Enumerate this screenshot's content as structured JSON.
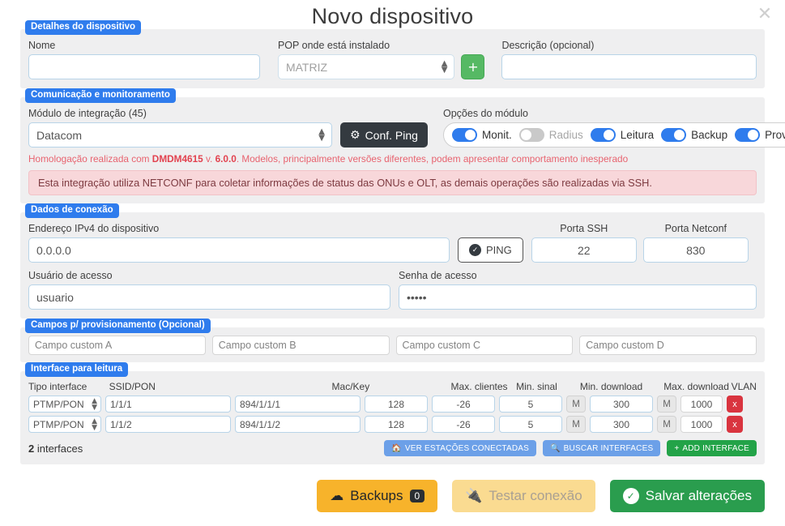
{
  "header": {
    "title": "Novo dispositivo",
    "close_icon": "close-icon"
  },
  "device_details": {
    "legend": "Detalhes do dispositivo",
    "name_label": "Nome",
    "name_value": "",
    "pop_label": "POP onde está instalado",
    "pop_value": "MATRIZ",
    "add_pop_icon": "+",
    "description_label": "Descrição (opcional)",
    "description_value": ""
  },
  "communication": {
    "legend": "Comunicação e monitoramento",
    "module_label": "Módulo de integração (45)",
    "module_value": "Datacom",
    "conf_ping_label": "Conf. Ping",
    "options_label": "Opções do módulo",
    "toggles": [
      {
        "label": "Monit.",
        "on": true
      },
      {
        "label": "Radius",
        "on": false
      },
      {
        "label": "Leitura",
        "on": true
      },
      {
        "label": "Backup",
        "on": true
      },
      {
        "label": "Provis.",
        "on": true
      }
    ],
    "homolog_prefix": "Homologação realizada com ",
    "homolog_model": "DMDM4615",
    "homolog_mid": " v. ",
    "homolog_version": "6.0.0",
    "homolog_suffix": ". Modelos, principalmente versões diferentes, podem apresentar comportamento inesperado",
    "alert_text": "Esta integração utiliza NETCONF para coletar informações de status das ONUs e OLT, as demais operações são realizadas via SSH."
  },
  "connection": {
    "legend": "Dados de conexão",
    "ip_label": "Endereço IPv4 do dispositivo",
    "ip_value": "0.0.0.0",
    "ping_label": "PING",
    "ssh_port_label": "Porta SSH",
    "ssh_port_value": "22",
    "netconf_port_label": "Porta Netconf",
    "netconf_port_value": "830",
    "user_label": "Usuário de acesso",
    "user_value": "usuario",
    "password_label": "Senha de acesso",
    "password_value": "•••••"
  },
  "provisioning": {
    "legend": "Campos p/ provisionamento (Opcional)",
    "fields": [
      {
        "placeholder": "Campo custom A",
        "value": ""
      },
      {
        "placeholder": "Campo custom B",
        "value": ""
      },
      {
        "placeholder": "Campo custom C",
        "value": ""
      },
      {
        "placeholder": "Campo custom D",
        "value": ""
      }
    ]
  },
  "interfaces": {
    "legend": "Interface para leitura",
    "columns": [
      "Tipo interface",
      "SSID/PON",
      "Mac/Key",
      "Max. clientes",
      "Min. sinal",
      "Min. download",
      "Max. download",
      "VLAN"
    ],
    "rows": [
      {
        "type": "PTMP/PON",
        "ssid": "1/1/1",
        "mackey": "894/1/1/1",
        "max_clients": "128",
        "min_signal": "-26",
        "min_download": "5",
        "min_unit": "M",
        "max_download": "300",
        "max_unit": "M",
        "vlan": "1000",
        "delete_label": "x"
      },
      {
        "type": "PTMP/PON",
        "ssid": "1/1/2",
        "mackey": "894/1/1/2",
        "max_clients": "128",
        "min_signal": "-26",
        "min_download": "5",
        "min_unit": "M",
        "max_download": "300",
        "max_unit": "M",
        "vlan": "1000",
        "delete_label": "x"
      }
    ],
    "count_number": "2",
    "count_word": " interfaces",
    "view_stations_label": "VER ESTAÇÕES CONECTADAS",
    "search_interfaces_label": "BUSCAR INTERFACES",
    "add_interface_label": "ADD INTERFACE"
  },
  "footer": {
    "backups_label": "Backups",
    "backups_count": "0",
    "test_connection_label": "Testar conexão",
    "save_label": "Salvar alterações"
  },
  "colors": {
    "legend_blue": "#2f7ced",
    "toggle_on": "#2f7ced",
    "green": "#2a9d4e",
    "amber": "#f7b32b",
    "danger": "#d9343f",
    "alert_bg": "#f8d7da"
  }
}
